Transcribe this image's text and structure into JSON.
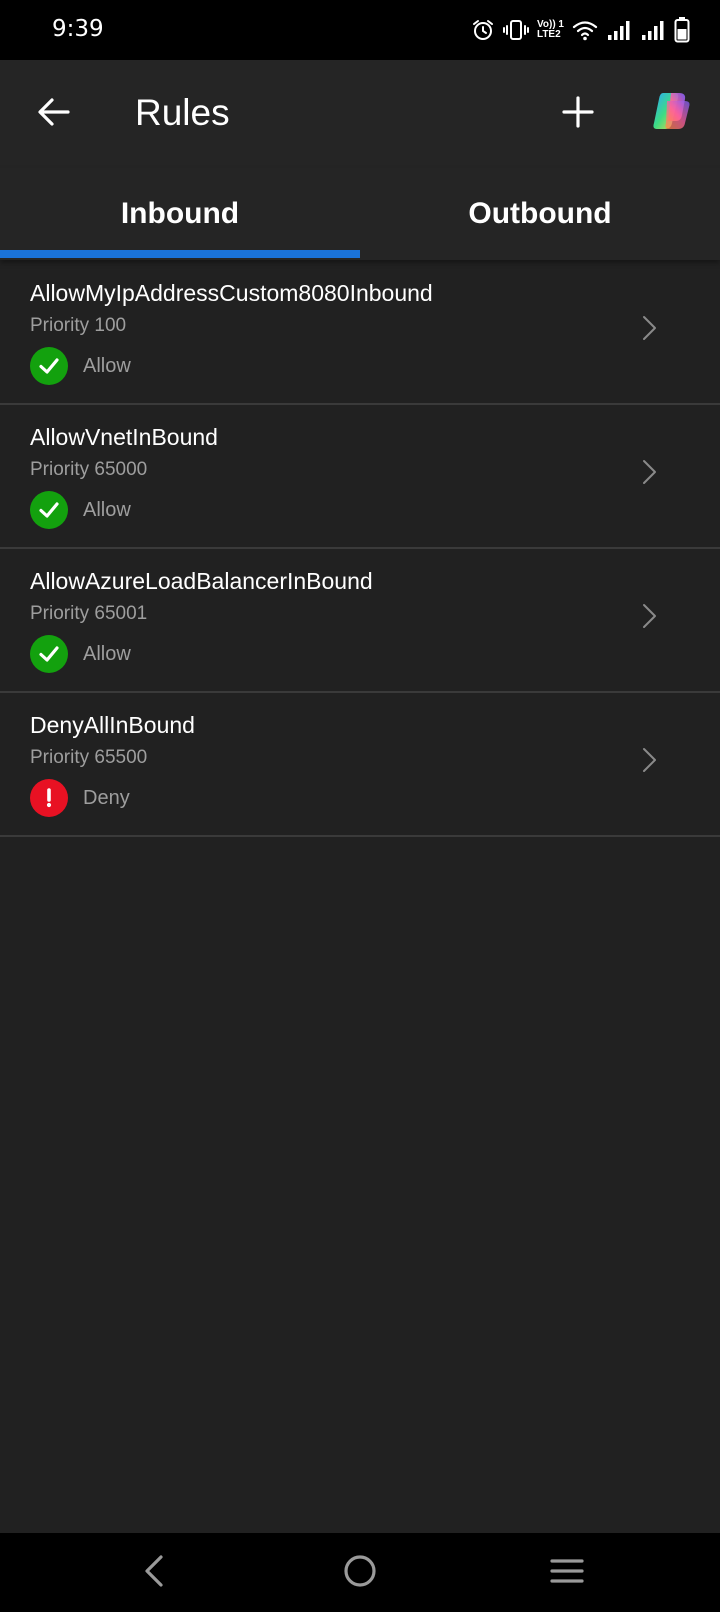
{
  "status_bar": {
    "time": "9:39",
    "icons": [
      "alarm-icon",
      "vibrate-icon",
      "volte-icon",
      "wifi-icon",
      "signal-icon",
      "signal-icon",
      "battery-icon"
    ],
    "volte_line1": "Vo)) 1",
    "volte_line2": "LTE2"
  },
  "header": {
    "title": "Rules",
    "back_icon": "arrow-left-icon",
    "add_icon": "plus-icon",
    "copilot_icon": "copilot-icon"
  },
  "tabs": [
    {
      "label": "Inbound",
      "selected": true
    },
    {
      "label": "Outbound",
      "selected": false
    }
  ],
  "rules": [
    {
      "name": "AllowMyIpAddressCustom8080Inbound",
      "priority": "Priority 100",
      "action": "Allow"
    },
    {
      "name": "AllowVnetInBound",
      "priority": "Priority 65000",
      "action": "Allow"
    },
    {
      "name": "AllowAzureLoadBalancerInBound",
      "priority": "Priority 65001",
      "action": "Allow"
    },
    {
      "name": "DenyAllInBound",
      "priority": "Priority 65500",
      "action": "Deny"
    }
  ],
  "colors": {
    "background": "#212121",
    "accent": "#1a73d9",
    "allow": "#13a10e",
    "deny": "#e81123",
    "secondary_text": "#9e9e9e"
  },
  "nav_bar": {
    "icons": [
      "nav-back-icon",
      "nav-home-icon",
      "nav-menu-icon"
    ]
  }
}
